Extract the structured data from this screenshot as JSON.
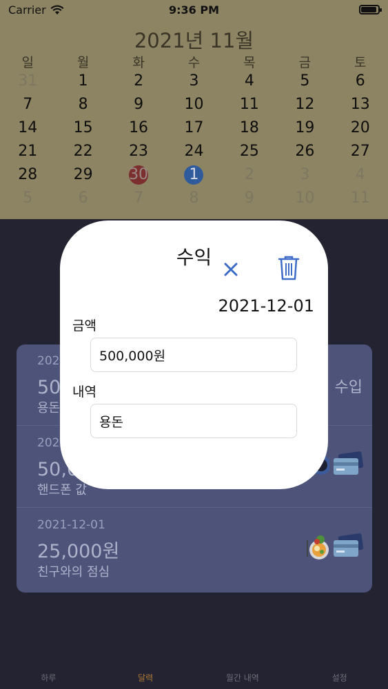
{
  "status_bar": {
    "carrier": "Carrier",
    "time": "9:36 PM",
    "battery_level": 0.9
  },
  "calendar": {
    "title": "2021년 11월",
    "weekdays": [
      "일",
      "월",
      "화",
      "수",
      "목",
      "금",
      "토"
    ],
    "weeks": [
      [
        {
          "d": "31",
          "dim": true
        },
        {
          "d": "1"
        },
        {
          "d": "2"
        },
        {
          "d": "3"
        },
        {
          "d": "4"
        },
        {
          "d": "5"
        },
        {
          "d": "6"
        }
      ],
      [
        {
          "d": "7"
        },
        {
          "d": "8"
        },
        {
          "d": "9"
        },
        {
          "d": "10"
        },
        {
          "d": "11"
        },
        {
          "d": "12"
        },
        {
          "d": "13"
        }
      ],
      [
        {
          "d": "14"
        },
        {
          "d": "15"
        },
        {
          "d": "16"
        },
        {
          "d": "17"
        },
        {
          "d": "18"
        },
        {
          "d": "19"
        },
        {
          "d": "20"
        }
      ],
      [
        {
          "d": "21"
        },
        {
          "d": "22"
        },
        {
          "d": "23"
        },
        {
          "d": "24"
        },
        {
          "d": "25"
        },
        {
          "d": "26"
        },
        {
          "d": "27"
        }
      ],
      [
        {
          "d": "28"
        },
        {
          "d": "29"
        },
        {
          "d": "30",
          "mark": "red"
        },
        {
          "d": "1",
          "mark": "blue"
        },
        {
          "d": "2",
          "dim": true
        },
        {
          "d": "3",
          "dim": true
        },
        {
          "d": "4",
          "dim": true
        }
      ],
      [
        {
          "d": "5",
          "dim": true
        },
        {
          "d": "6",
          "dim": true
        },
        {
          "d": "7",
          "dim": true
        },
        {
          "d": "8",
          "dim": true
        },
        {
          "d": "9",
          "dim": true
        },
        {
          "d": "10",
          "dim": true
        },
        {
          "d": "11",
          "dim": true
        }
      ]
    ]
  },
  "modal": {
    "title": "수익",
    "close_icon": "close-icon",
    "delete_icon": "trash-icon",
    "date": "2021-12-01",
    "amount_label": "금액",
    "amount_value": "500,000원",
    "memo_label": "내역",
    "memo_value": "용돈"
  },
  "list": {
    "items": [
      {
        "date": "2021-12-01",
        "amount": "500,000원",
        "desc": "용돈",
        "type": "수입"
      },
      {
        "date": "2021-12-01",
        "amount": "50,000원",
        "desc": "핸드폰 값"
      },
      {
        "date": "2021-12-01",
        "amount": "25,000원",
        "desc": "친구와의 점심"
      }
    ]
  },
  "tabs": [
    {
      "label": "하루",
      "active": false
    },
    {
      "label": "달력",
      "active": true
    },
    {
      "label": "월간 내역",
      "active": false
    },
    {
      "label": "설정",
      "active": false
    }
  ],
  "colors": {
    "calendar_bg": "#8c8463",
    "background": "#232331",
    "list_bg": "#4d5379",
    "accent_blue": "#3c6bc8",
    "tab_active": "#b07a36"
  }
}
